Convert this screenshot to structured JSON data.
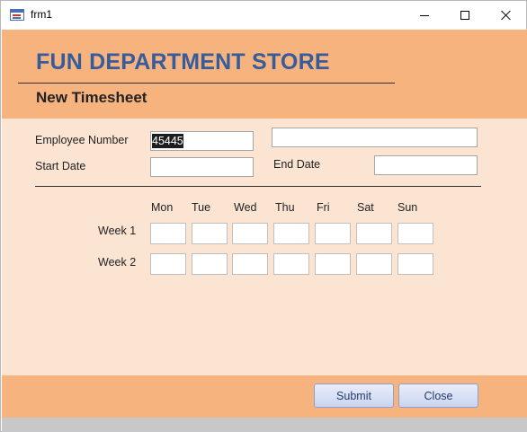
{
  "window": {
    "title": "frm1"
  },
  "header": {
    "store_title": "FUN DEPARTMENT STORE",
    "form_subtitle": "New Timesheet"
  },
  "fields": {
    "employee_number_label": "Employee Number",
    "employee_number_value": "45445",
    "employee_name_value": "",
    "start_date_label": "Start Date",
    "start_date_value": "",
    "end_date_label": "End Date",
    "end_date_value": ""
  },
  "grid": {
    "days": [
      "Mon",
      "Tue",
      "Wed",
      "Thu",
      "Fri",
      "Sat",
      "Sun"
    ],
    "weeks": [
      "Week 1",
      "Week 2"
    ]
  },
  "footer": {
    "submit_label": "Submit",
    "close_label": "Close"
  },
  "colors": {
    "header_bg": "#f6b37d",
    "body_bg": "#fce4d3",
    "title_blue": "#355c9c"
  },
  "icons": {
    "app": "form-icon",
    "minimize": "minimize-icon",
    "maximize": "maximize-icon",
    "close": "close-icon"
  }
}
